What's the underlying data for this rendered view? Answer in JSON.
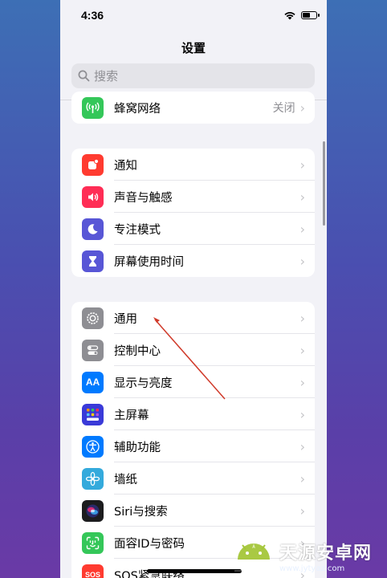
{
  "status_bar": {
    "time": "4:36"
  },
  "nav": {
    "title": "设置"
  },
  "search": {
    "placeholder": "搜索"
  },
  "group1": [
    {
      "label": "蜂窝网络",
      "value": "关闭",
      "icon": "antenna-icon",
      "color": "#34c759"
    }
  ],
  "group2": [
    {
      "label": "通知",
      "icon": "bell-icon",
      "color": "#ff3b30"
    },
    {
      "label": "声音与触感",
      "icon": "speaker-icon",
      "color": "#ff2d55"
    },
    {
      "label": "专注模式",
      "icon": "moon-icon",
      "color": "#5856d6"
    },
    {
      "label": "屏幕使用时间",
      "icon": "hourglass-icon",
      "color": "#5856d6"
    }
  ],
  "group3": [
    {
      "label": "通用",
      "icon": "gear-icon",
      "color": "#8e8e93"
    },
    {
      "label": "控制中心",
      "icon": "toggles-icon",
      "color": "#8e8e93"
    },
    {
      "label": "显示与亮度",
      "icon": "text-size-icon",
      "color": "#007aff",
      "glyph": "AA"
    },
    {
      "label": "主屏幕",
      "icon": "home-grid-icon",
      "color": "#3a3ad8"
    },
    {
      "label": "辅助功能",
      "icon": "accessibility-icon",
      "color": "#007aff"
    },
    {
      "label": "墙纸",
      "icon": "flower-icon",
      "color": "#34aadc"
    },
    {
      "label": "Siri与搜索",
      "icon": "siri-icon",
      "color": "#1c1c1e"
    },
    {
      "label": "面容ID与密码",
      "icon": "face-id-icon",
      "color": "#34c759"
    },
    {
      "label": "SOS紧急联络",
      "icon": "sos-icon",
      "color": "#ff3b30",
      "glyph": "SOS"
    }
  ],
  "watermark": {
    "brand": "天源安卓网",
    "url": "www.jytyaz.com"
  },
  "colors": {
    "background": "#f2f2f7",
    "annotation_arrow": "#d03a2a"
  }
}
